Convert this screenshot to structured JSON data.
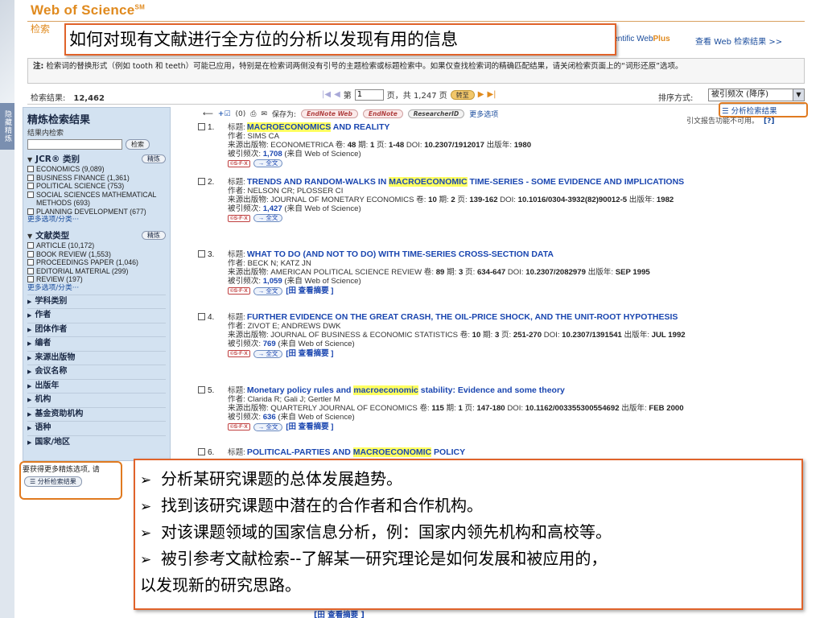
{
  "header": {
    "logo": "Web of Science",
    "logo_mark": "SM",
    "tab_label": "检索",
    "webplus_prefix": "ientific Web",
    "webplus_suffix": "Plus",
    "webplus_link": "查看 Web 检索结果 >>"
  },
  "overlay_title": "如何对现有文献进行全方位的分析以发现有用的信息",
  "note": {
    "label": "注:",
    "text": "检索词的替换形式（例如 tooth 和 teeth）可能已应用，特别是在检索词两侧没有引号的主题检索或标题检索中。如果仅查找检索词的精确匹配结果，请关闭检索页面上的“词形还原”选项。"
  },
  "toolbar": {
    "results_label": "检索结果:",
    "results_count": "12,462",
    "page_prefix": "第",
    "page_value": "1",
    "page_suffix": "页，共 1,247 页",
    "go_label": "转至",
    "sort_label": "排序方式:",
    "sort_value": "被引频次 (降序)"
  },
  "sidebar": {
    "title": "精炼检索结果",
    "subtitle": "结果内检索",
    "search_button": "检索",
    "refine_label": "精炼",
    "jcr_title": "JCR® 类别",
    "jcr_items": [
      "ECONOMICS (9,089)",
      "BUSINESS FINANCE (1,361)",
      "POLITICAL SCIENCE (753)",
      "SOCIAL SCIENCES MATHEMATICAL METHODS (693)",
      "PLANNING DEVELOPMENT (677)"
    ],
    "more_label": "更多选项/分类···",
    "doctype_title": "文献类型",
    "doctype_items": [
      "ARTICLE (10,172)",
      "BOOK REVIEW (1,553)",
      "PROCEEDINGS PAPER (1,046)",
      "EDITORIAL MATERIAL (299)",
      "REVIEW (197)"
    ],
    "categories": [
      "学科类别",
      "作者",
      "团体作者",
      "编者",
      "来源出版物",
      "会议名称",
      "出版年",
      "机构",
      "基金资助机构",
      "语种",
      "国家/地区"
    ],
    "footer_text": "要获得更多精炼选项, 请",
    "footer_button": "分析检索结果"
  },
  "actions": {
    "count": "(0)",
    "save_to": "保存为:",
    "pills": [
      "EndNote Web",
      "EndNote",
      "ResearcherID"
    ],
    "more": "更多选项",
    "analyze": "分析检索结果",
    "cite_note": "引文报告功能不可用。",
    "help": "[?]"
  },
  "records": [
    {
      "num": "1.",
      "title_label": "标题:",
      "title_parts": [
        [
          "MACROECONOMICS",
          true
        ],
        [
          " AND REALITY",
          false
        ]
      ],
      "author": "作者: SIMS CA",
      "source_prefix": "来源出版物: ECONOMETRICA  卷: ",
      "vol": "48",
      "issue_label": "期: ",
      "issue": "1",
      "page_label": "页: ",
      "pages": "1-48",
      "doi_label": "DOI: ",
      "doi": "10.2307/1912017",
      "year_label": "出版年: ",
      "year": "1980",
      "cited_prefix": "被引频次: ",
      "cited": "1,708",
      "cited_suffix": " (来自 Web of Science)",
      "sfx": "©S·F·X",
      "fulltext": "→ 全文",
      "abstract": ""
    },
    {
      "num": "2.",
      "title_label": "标题:",
      "title_parts": [
        [
          "TRENDS AND RANDOM-WALKS IN ",
          false
        ],
        [
          "MACROECONOMIC",
          true
        ],
        [
          " TIME-SERIES - SOME EVIDENCE AND IMPLICATIONS",
          false
        ]
      ],
      "author": "作者: NELSON CR; PLOSSER CI",
      "source_prefix": "来源出版物: JOURNAL OF MONETARY ECONOMICS  卷: ",
      "vol": "10",
      "issue_label": "期: ",
      "issue": "2",
      "page_label": "页: ",
      "pages": "139-162",
      "doi_label": "DOI: ",
      "doi": "10.1016/0304-3932(82)90012-5",
      "year_label": "出版年: ",
      "year": "1982",
      "cited_prefix": "被引频次: ",
      "cited": "1,427",
      "cited_suffix": " (来自 Web of Science)",
      "sfx": "©S·F·X",
      "fulltext": "→ 全文",
      "abstract": ""
    },
    {
      "num": "3.",
      "title_label": "标题:",
      "title_parts": [
        [
          "WHAT TO DO (AND NOT TO DO) WITH TIME-SERIES CROSS-SECTION DATA",
          false
        ]
      ],
      "author": "作者: BECK N; KATZ JN",
      "source_prefix": "来源出版物: AMERICAN POLITICAL SCIENCE REVIEW  卷: ",
      "vol": "89",
      "issue_label": "期: ",
      "issue": "3",
      "page_label": "页: ",
      "pages": "634-647",
      "doi_label": "DOI: ",
      "doi": "10.2307/2082979",
      "year_label": "出版年: ",
      "year": "SEP 1995",
      "cited_prefix": "被引频次: ",
      "cited": "1,059",
      "cited_suffix": " (来自 Web of Science)",
      "sfx": "©S·F·X",
      "fulltext": "→ 全文",
      "abstract": "[田 查看摘要 ]"
    },
    {
      "num": "4.",
      "title_label": "标题:",
      "title_parts": [
        [
          "FURTHER EVIDENCE ON THE GREAT CRASH, THE OIL-PRICE SHOCK, AND THE UNIT-ROOT HYPOTHESIS",
          false
        ]
      ],
      "author": "作者: ZIVOT E; ANDREWS DWK",
      "source_prefix": "来源出版物: JOURNAL OF BUSINESS & ECONOMIC STATISTICS  卷: ",
      "vol": "10",
      "issue_label": "期: ",
      "issue": "3",
      "page_label": "页: ",
      "pages": "251-270",
      "doi_label": "DOI: ",
      "doi": "10.2307/1391541",
      "year_label": "出版年: ",
      "year": "JUL 1992",
      "cited_prefix": "被引频次: ",
      "cited": "769",
      "cited_suffix": " (来自 Web of Science)",
      "sfx": "©S·F·X",
      "fulltext": "→ 全文",
      "abstract": "[田 查看摘要 ]"
    },
    {
      "num": "5.",
      "title_label": "标题:",
      "title_parts": [
        [
          "Monetary policy rules and ",
          false
        ],
        [
          "macroeconomic",
          true
        ],
        [
          " stability: Evidence and some theory",
          false
        ]
      ],
      "author": "作者: Clarida R; Gali J; Gertler M",
      "source_prefix": "来源出版物: QUARTERLY JOURNAL OF ECONOMICS  卷: ",
      "vol": "115",
      "issue_label": "期: ",
      "issue": "1",
      "page_label": "页: ",
      "pages": "147-180",
      "doi_label": "DOI: ",
      "doi": "10.1162/003355300554692",
      "year_label": "出版年: ",
      "year": "FEB 2000",
      "cited_prefix": "被引频次: ",
      "cited": "636",
      "cited_suffix": " (来自 Web of Science)",
      "sfx": "©S·F·X",
      "fulltext": "→ 全文",
      "abstract": "[田 查看摘要 ]"
    },
    {
      "num": "6.",
      "title_label": "标题:",
      "title_parts": [
        [
          "POLITICAL-PARTIES AND ",
          false
        ],
        [
          "MACROECONOMIC",
          true
        ],
        [
          " POLICY",
          false
        ]
      ],
      "author": "",
      "source_prefix": "",
      "vol": "",
      "issue_label": "",
      "issue": "",
      "page_label": "",
      "pages": "",
      "doi_label": "",
      "doi": "",
      "year_label": "",
      "year": "",
      "cited_prefix": "",
      "cited": "",
      "cited_suffix": "",
      "sfx": "",
      "fulltext": "",
      "abstract": ""
    }
  ],
  "overlay_bullets": [
    "分析某研究课题的总体发展趋势。",
    "找到该研究课题中潜在的合作者和合作机构。",
    "对该课题领域的国家信息分析，例：国家内领先机构和高校等。",
    "被引参考文献检索--了解某一研究理论是如何发展和被应用的，"
  ],
  "overlay_continuation": "以发现新的研究思路。",
  "bullet_mark": "➢",
  "left_tab_label": "隐藏精炼",
  "bottom_peek": "[田 查看摘要 ]"
}
